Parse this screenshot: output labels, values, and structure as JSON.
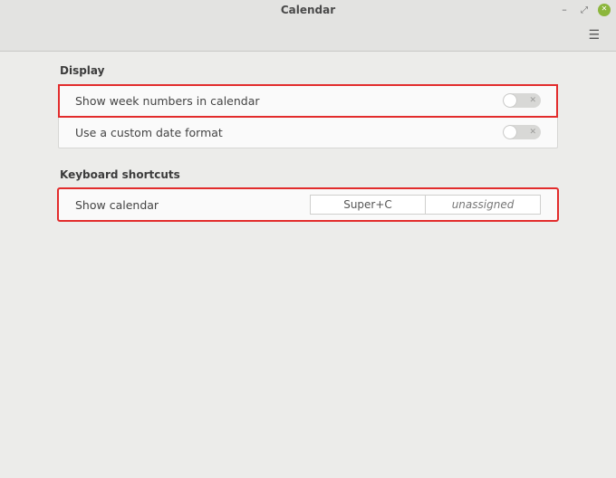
{
  "window": {
    "title": "Calendar"
  },
  "sections": {
    "display": {
      "header": "Display",
      "rows": {
        "week_numbers": {
          "label": "Show week numbers in calendar",
          "enabled": false
        },
        "custom_date": {
          "label": "Use a custom date format",
          "enabled": false
        }
      }
    },
    "shortcuts": {
      "header": "Keyboard shortcuts",
      "rows": {
        "show_calendar": {
          "label": "Show calendar",
          "primary": "Super+C",
          "secondary": "unassigned"
        }
      }
    }
  }
}
